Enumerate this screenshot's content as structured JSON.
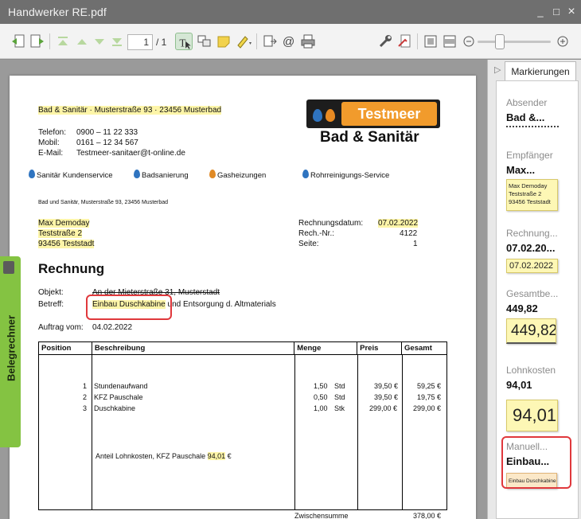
{
  "window": {
    "title": "Handwerker RE.pdf",
    "minimize": "_",
    "maximize": "□",
    "close": "×"
  },
  "toolbar": {
    "page_current": "1",
    "page_separator": "/ 1"
  },
  "invoice": {
    "sender_line": "Bad & Sanitär  ·  Musterstraße 93 · 23456 Musterbad",
    "contact": [
      {
        "label": "Telefon:",
        "value": "0900 – 11  22 333"
      },
      {
        "label": "Mobil:",
        "value": "0161 – 12 34 567"
      },
      {
        "label": "E-Mail:",
        "value": "Testmeer-sanitaer@t-online.de"
      }
    ],
    "logo_name": "Testmeer",
    "logo_subtitle": "Bad & Sanitär",
    "services": [
      "Sanitär Kundenservice",
      "Badsanierung",
      "Gasheizungen",
      "Rohrreinigungs-Service"
    ],
    "return_address": "Bad und Sanitär, Musterstraße 93, 23456 Musterbad",
    "recipient": [
      "Max Demoday",
      "Teststraße 2",
      "93456 Teststadt"
    ],
    "meta": [
      {
        "label": "Rechnungsdatum:",
        "value": "07.02.2022"
      },
      {
        "label": "Rech.-Nr.:",
        "value": "4122"
      },
      {
        "label": "Seite:",
        "value": "1"
      }
    ],
    "heading": "Rechnung",
    "object_label": "Objekt:",
    "object_value": "An der Mieterstraße 31, Musterstadt",
    "subject_label": "Betreff:",
    "subject_highlight": "Einbau Duschkabine",
    "subject_rest": " und Entsorgung d. Altmaterials",
    "order_label": "Auftrag vom:",
    "order_value": "04.02.2022",
    "columns": [
      "Position",
      "Beschreibung",
      "Menge",
      "Preis",
      "Gesamt"
    ],
    "rows": [
      {
        "pos": "1",
        "desc": "Stundenaufwand",
        "qty": "1,50",
        "unit": "Std",
        "price": "39,50 €",
        "total": "59,25 €"
      },
      {
        "pos": "2",
        "desc": "KFZ Pauschale",
        "qty": "0,50",
        "unit": "Std",
        "price": "39,50 €",
        "total": "19,75 €"
      },
      {
        "pos": "3",
        "desc": "Duschkabine",
        "qty": "1,00",
        "unit": "Stk",
        "price": "299,00 €",
        "total": "299,00 €"
      }
    ],
    "labor_note": "Anteil Lohnkosten, KFZ Pauschale",
    "labor_value": "94,01",
    "labor_currency": "€",
    "subtotal_label": "Zwischensumme",
    "subtotal_value": "378,00 €"
  },
  "sidetab": {
    "label": "Belegrechner"
  },
  "panel": {
    "tab": "Markierungen",
    "cards": [
      {
        "label": "Absender",
        "value": "Bad &..."
      },
      {
        "label": "Empfänger",
        "value": "Max...",
        "thumb": [
          "Max Demoday",
          "Teststraße 2",
          "93456 Teststadt"
        ]
      },
      {
        "label": "Rechnung...",
        "value": "07.02.20...",
        "thumb": "07.02.2022"
      },
      {
        "label": "Gesamtbe...",
        "value": "449,82",
        "thumb": "449,82"
      },
      {
        "label": "Lohnkosten",
        "value": "94,01",
        "thumb": "94,01"
      },
      {
        "label": "Manuell...",
        "value": "Einbau...",
        "thumb": "Einbau Duschkabine"
      }
    ]
  },
  "colors": {
    "highlight": "#fdf5a8",
    "accent_green": "#84c342",
    "logo_orange": "#f19b2c",
    "markup_red": "#e0383c"
  }
}
